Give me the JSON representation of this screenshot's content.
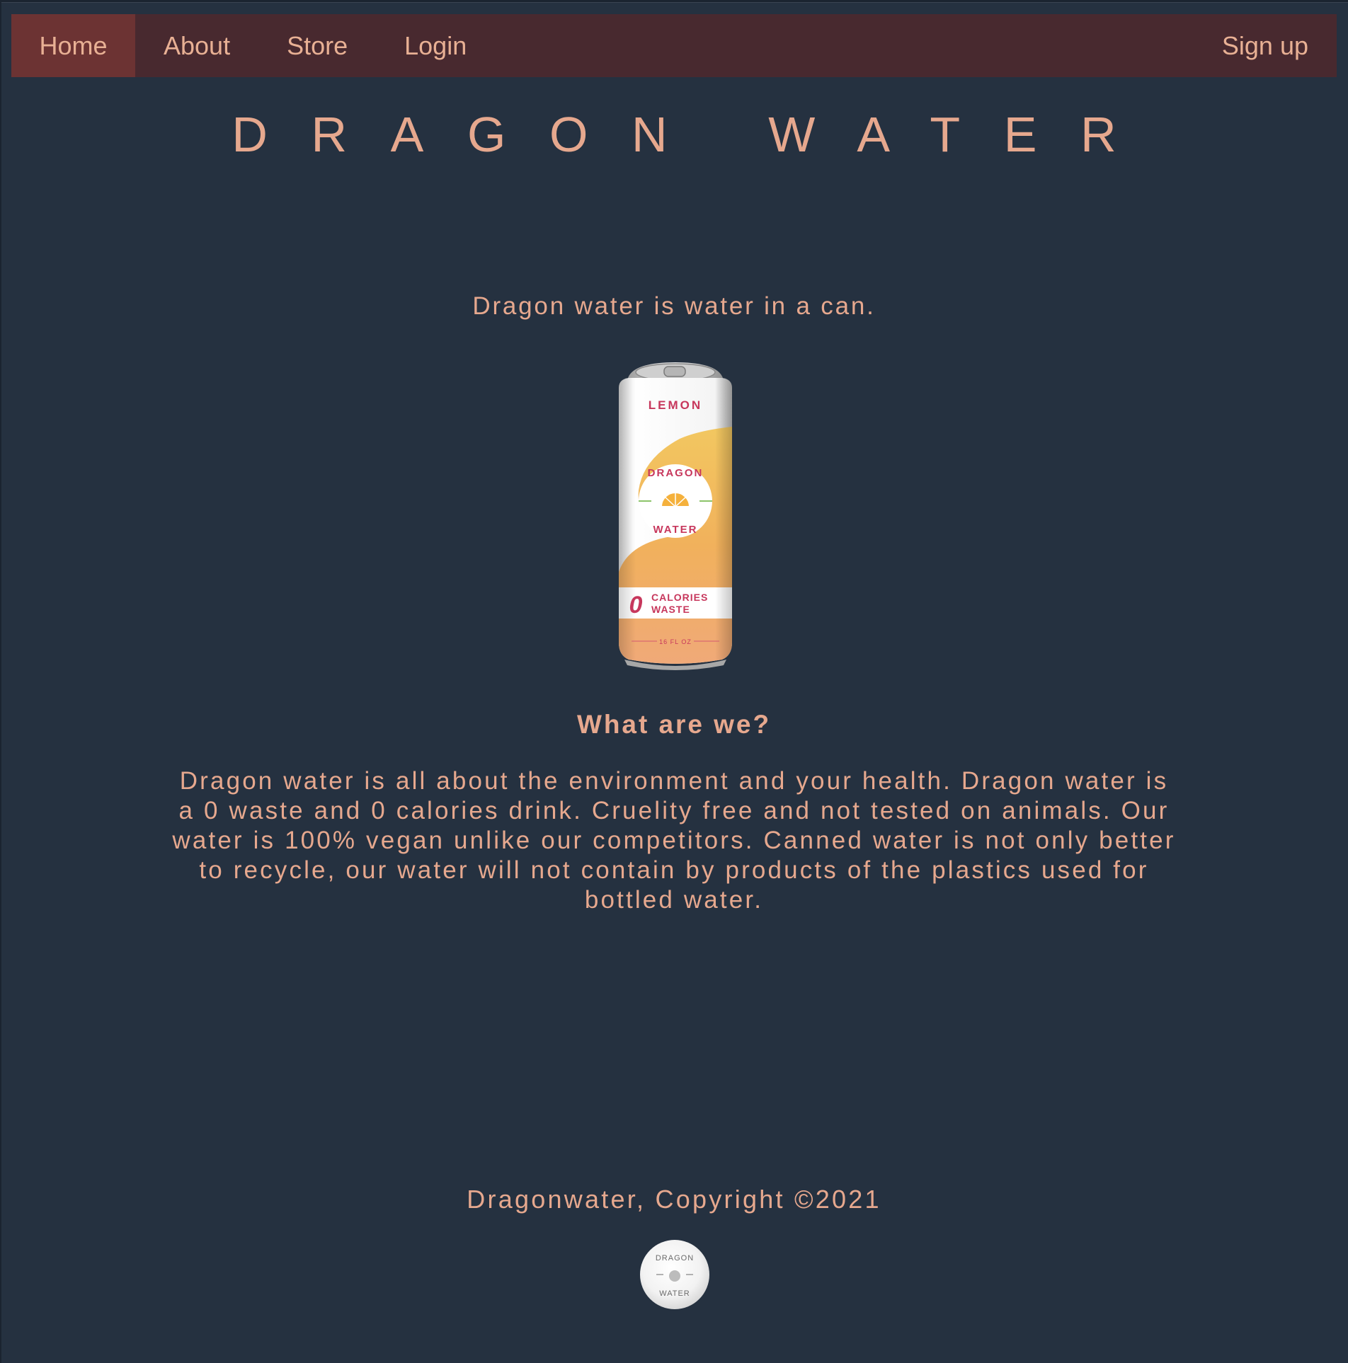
{
  "nav": {
    "home": "Home",
    "about": "About",
    "store": "Store",
    "login": "Login",
    "signup": "Sign up"
  },
  "site_title": "DRAGON WATER",
  "tagline": "Dragon water is water in a can.",
  "product_image": {
    "flavor": "LEMON",
    "brand_top": "DRAGON",
    "brand_bottom": "WATER",
    "zero": "0",
    "label_line1": "CALORIES",
    "label_line2": "WASTE",
    "volume": "16 FL OZ"
  },
  "section": {
    "heading": "What are we?",
    "body": "Dragon water is all about the environment and your health. Dragon water is a 0 waste and 0 calories drink. Cruelity free and not tested on animals. Our water is 100% vegan unlike our competitors. Canned water is not only better to recycle, our water will not contain by products of the plastics used for bottled water."
  },
  "footer": {
    "copyright": "Dragonwater, Copyright ©2021",
    "logo_top": "DRAGON",
    "logo_bottom": "WATER"
  },
  "colors": {
    "background": "#253140",
    "navbar": "#48292f",
    "nav_active": "#6c3333",
    "text": "#e6a88e"
  }
}
